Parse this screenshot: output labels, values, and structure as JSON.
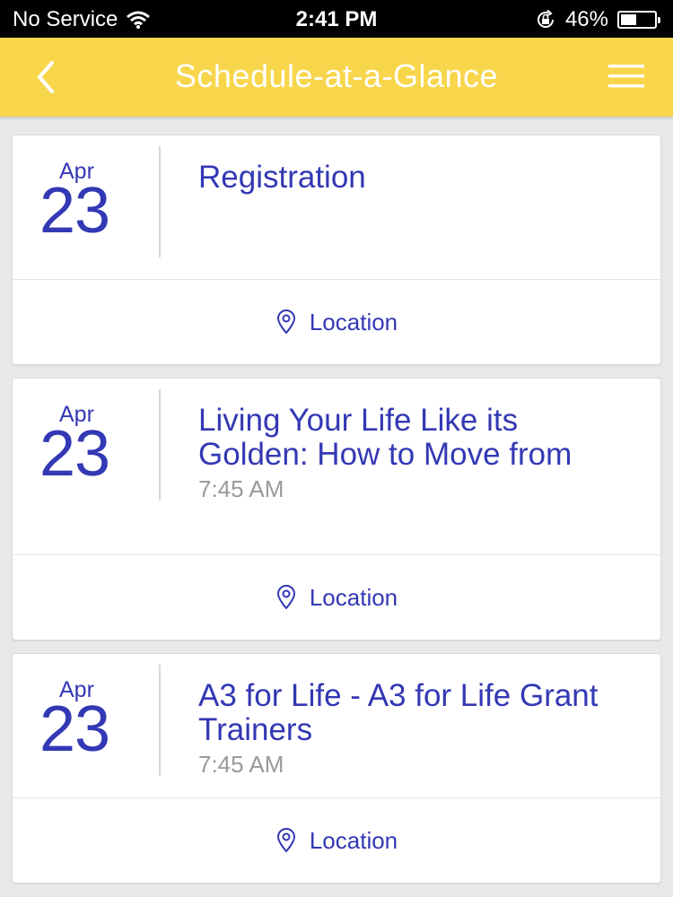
{
  "status_bar": {
    "carrier": "No Service",
    "time": "2:41 PM",
    "battery_percent": "46%",
    "battery_level": 0.46
  },
  "nav": {
    "title": "Schedule-at-a-Glance",
    "back_icon": "chevron-left-icon",
    "menu_icon": "hamburger-menu-icon"
  },
  "colors": {
    "nav_background": "#f8d64b",
    "accent_text": "#3338b4",
    "muted_text": "#9a9a9a"
  },
  "events": [
    {
      "month": "Apr",
      "day": "23",
      "title": "Registration",
      "time": "",
      "location_label": "Location"
    },
    {
      "month": "Apr",
      "day": "23",
      "title": "Living Your Life Like its Golden: How to Move from",
      "time": "7:45 AM",
      "location_label": "Location"
    },
    {
      "month": "Apr",
      "day": "23",
      "title": "A3 for Life - A3 for Life Grant Trainers",
      "time": "7:45 AM",
      "location_label": "Location"
    }
  ]
}
